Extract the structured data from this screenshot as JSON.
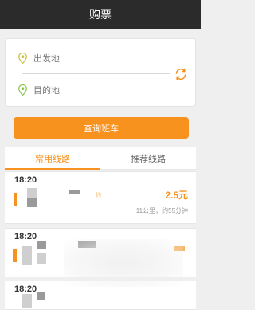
{
  "header": {
    "title": "购票"
  },
  "form": {
    "from_placeholder": "出发地",
    "to_placeholder": "目的地",
    "query_label": "查询班车"
  },
  "tabs": [
    {
      "label": "常用线路",
      "active": true
    },
    {
      "label": "推荐线路",
      "active": false
    }
  ],
  "routes": [
    {
      "time": "18:20",
      "price": "2.5元",
      "meta": "11公里，约55分钟",
      "tag": "约"
    },
    {
      "time": "18:20"
    },
    {
      "time": "18:20"
    }
  ],
  "colors": {
    "accent": "#f7921e",
    "header_bg": "#2b2b2b",
    "pin_green": "#8bc34a",
    "pin_yellow": "#c8c13a"
  }
}
